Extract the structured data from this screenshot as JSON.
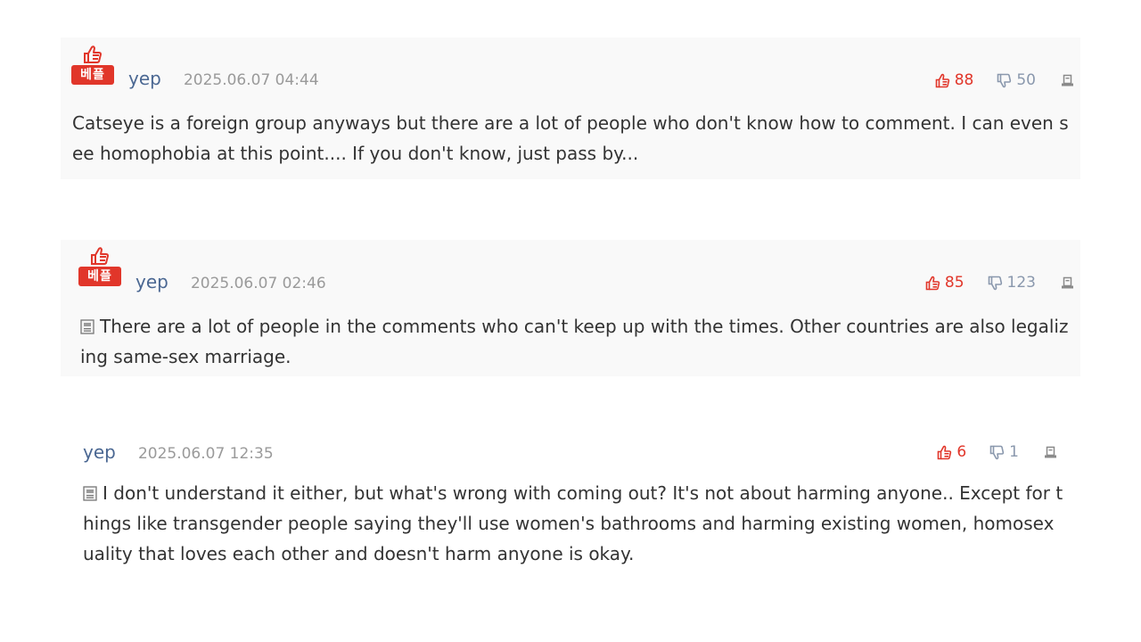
{
  "comments": [
    {
      "best": true,
      "badge_label": "베플",
      "author": "yep",
      "date": "2025.06.07 04:44",
      "likes": "88",
      "dislikes": "50",
      "has_memo_icon": false,
      "text": "Catseye is a foreign group anyways but there are a lot of people who don't know how to comment. I can even see homophobia at this point.... If you don't know, just pass by..."
    },
    {
      "best": true,
      "badge_label": "베플",
      "author": "yep",
      "date": "2025.06.07 02:46",
      "likes": "85",
      "dislikes": "123",
      "has_memo_icon": true,
      "text": "There are a lot of people in the comments who can't keep up with the times. Other countries are also legalizing same-sex marriage."
    },
    {
      "best": false,
      "author": "yep",
      "date": "2025.06.07 12:35",
      "likes": "6",
      "dislikes": "1",
      "has_memo_icon": true,
      "text": "I don't understand it either, but what's wrong with coming out? It's not about harming anyone.. Except for things like transgender people saying they'll use women's bathrooms and harming existing women, homosexuality that loves each other and doesn't harm anyone is okay."
    }
  ],
  "icons": {
    "badge": "thumbs-up-icon",
    "like": "thumbs-up-icon",
    "dislike": "thumbs-down-icon",
    "report": "report-icon",
    "memo": "memo-icon"
  },
  "colors": {
    "accent_red": "#e1362a",
    "author_blue": "#4a6792",
    "date_gray": "#9a9a9a",
    "best_background": "#f9f9f9"
  }
}
